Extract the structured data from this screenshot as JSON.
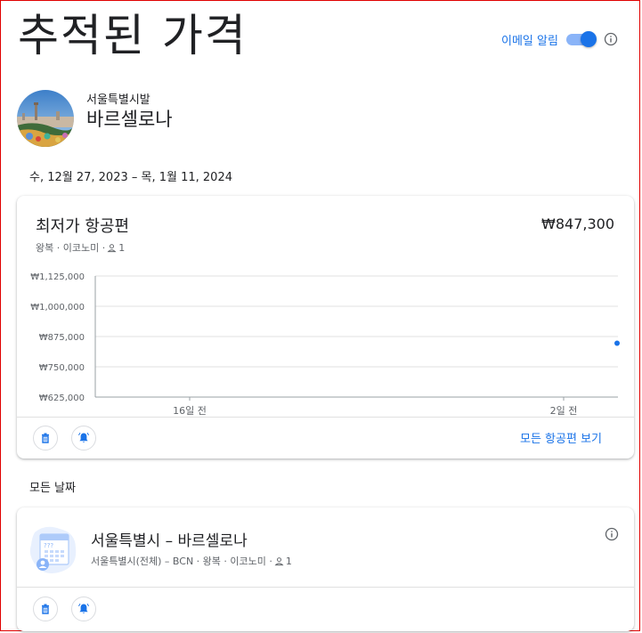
{
  "page": {
    "title": "추적된 가격"
  },
  "email_alert": {
    "label": "이메일 알림",
    "enabled": true
  },
  "destination": {
    "origin": "서울특별시발",
    "name": "바르셀로나"
  },
  "date_range": "수, 12월 27, 2023 – 목, 1월 11, 2024",
  "cheapest_card": {
    "title": "최저가 항공편",
    "price": "₩847,300",
    "subtitle": "왕복 · 이코노미 ·",
    "passengers": "1",
    "view_all_label": "모든 항공편 보기"
  },
  "chart_data": {
    "type": "scatter",
    "y_ticks": [
      "₩1,125,000",
      "₩1,000,000",
      "₩875,000",
      "₩750,000",
      "₩625,000"
    ],
    "ylim": [
      625000,
      1125000
    ],
    "x_ticks": [
      {
        "label": "16일 전",
        "days_ago": 16
      },
      {
        "label": "2일 전",
        "days_ago": 2
      }
    ],
    "points": [
      {
        "days_ago": 0,
        "price": 847300
      }
    ],
    "grid": true,
    "color": "#1a73e8"
  },
  "all_dates": {
    "label": "모든 날짜",
    "route": {
      "title": "서울특별시 – 바르셀로나",
      "subtitle": "서울특별시(전체) – BCN · 왕복 · 이코노미 ·",
      "passengers": "1"
    }
  },
  "colors": {
    "accent": "#1a73e8",
    "toggle_track": "#8ab4f8"
  }
}
